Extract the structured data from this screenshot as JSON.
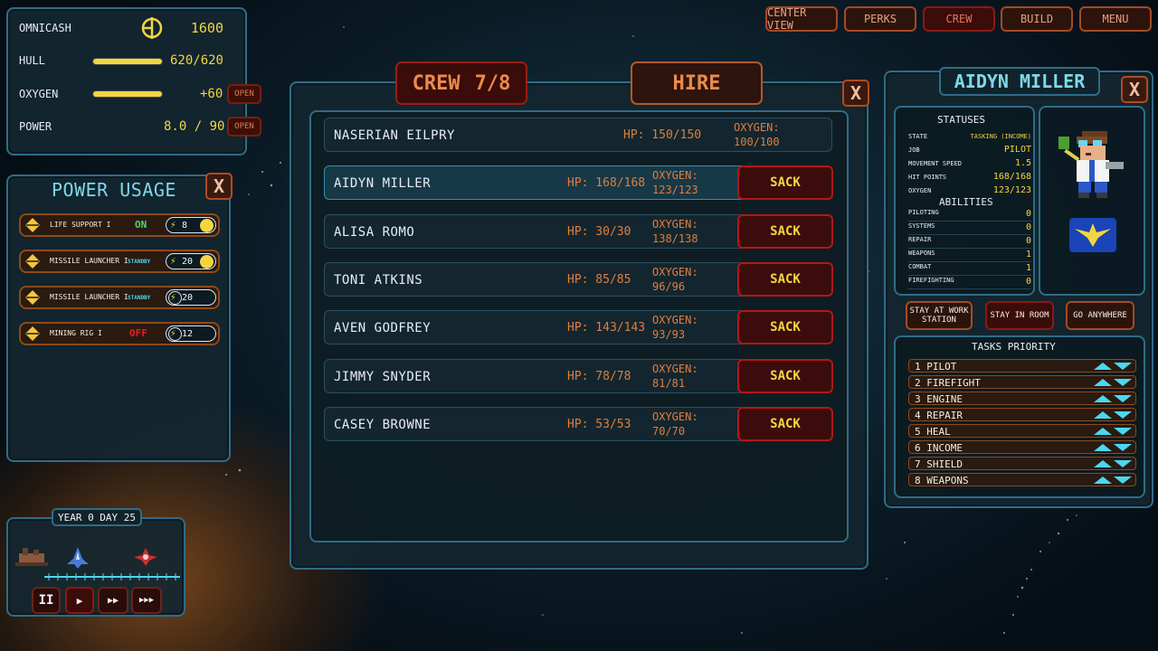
{
  "resources": {
    "omnicash_label": "OMNICASH",
    "omnicash_value": "1600",
    "hull_label": "HULL",
    "hull_value": "620/620",
    "hull_fraction": 1.0,
    "oxygen_label": "OXYGEN",
    "oxygen_value": "+60",
    "oxygen_fraction": 1.0,
    "oxygen_open": "OPEN",
    "power_label": "POWER",
    "power_value": "8.0 / 90.0",
    "power_open": "OPEN"
  },
  "top_menu": {
    "center_view": "CENTER VIEW",
    "perks": "PERKS",
    "crew": "CREW",
    "build": "BUILD",
    "menu": "MENU"
  },
  "power_usage": {
    "title": "POWER USAGE",
    "close": "X",
    "items": [
      {
        "name": "LIFE SUPPORT I",
        "state": "ON",
        "power": "8",
        "enabled": true
      },
      {
        "name": "MISSILE LAUNCHER I",
        "state": "STANDBY",
        "power": "20",
        "enabled": true
      },
      {
        "name": "MISSILE LAUNCHER I",
        "state": "STANDBY",
        "power": "20",
        "enabled": false
      },
      {
        "name": "MINING RIG I",
        "state": "OFF",
        "power": "12",
        "enabled": false
      }
    ]
  },
  "crew_panel": {
    "tab_crew": "CREW",
    "tab_count": "7/8",
    "tab_hire": "HIRE",
    "close": "X",
    "sack_label": "SACK",
    "members": [
      {
        "name": "NASERIAN EILPRY",
        "hp": "HP: 150/150",
        "oxygen_label": "OXYGEN:",
        "oxygen": "100/100",
        "can_sack": false
      },
      {
        "name": "AIDYN MILLER",
        "hp": "HP: 168/168",
        "oxygen_label": "OXYGEN:",
        "oxygen": "123/123",
        "can_sack": true
      },
      {
        "name": "ALISA ROMO",
        "hp": "HP: 30/30",
        "oxygen_label": "OXYGEN:",
        "oxygen": "138/138",
        "can_sack": true
      },
      {
        "name": "TONI ATKINS",
        "hp": "HP: 85/85",
        "oxygen_label": "OXYGEN:",
        "oxygen": "96/96",
        "can_sack": true
      },
      {
        "name": "AVEN GODFREY",
        "hp": "HP: 143/143",
        "oxygen_label": "OXYGEN:",
        "oxygen": "93/93",
        "can_sack": true
      },
      {
        "name": "JIMMY SNYDER",
        "hp": "HP: 78/78",
        "oxygen_label": "OXYGEN:",
        "oxygen": "81/81",
        "can_sack": true
      },
      {
        "name": "CASEY BROWNE",
        "hp": "HP: 53/53",
        "oxygen_label": "OXYGEN:",
        "oxygen": "70/70",
        "can_sack": true
      }
    ]
  },
  "crew_detail": {
    "name": "AIDYN MILLER",
    "close": "X",
    "statuses_title": "STATUSES",
    "statuses": [
      {
        "label": "STATE",
        "value": "TASKING (INCOME)"
      },
      {
        "label": "JOB",
        "value": "PILOT"
      },
      {
        "label": "MOVEMENT SPEED",
        "value": "1.5"
      },
      {
        "label": "HIT POINTS",
        "value": "168/168"
      },
      {
        "label": "OXYGEN",
        "value": "123/123"
      }
    ],
    "abilities_title": "ABILITIES",
    "abilities": [
      {
        "label": "PILOTING",
        "value": "0"
      },
      {
        "label": "SYSTEMS",
        "value": "0"
      },
      {
        "label": "REPAIR",
        "value": "0"
      },
      {
        "label": "WEAPONS",
        "value": "1"
      },
      {
        "label": "COMBAT",
        "value": "1"
      },
      {
        "label": "FIREFIGHTING",
        "value": "0"
      }
    ],
    "buttons": {
      "stay_station": "STAY AT WORK STATION",
      "stay_room": "STAY IN ROOM",
      "go_anywhere": "GO ANYWHERE"
    },
    "tasks_title": "TASKS PRIORITY",
    "tasks": [
      "1 PILOT",
      "2 FIREFIGHT",
      "3 ENGINE",
      "4 REPAIR",
      "5 HEAL",
      "6 INCOME",
      "7 SHIELD",
      "8 WEAPONS"
    ]
  },
  "timeline": {
    "date": "YEAR 0 DAY 25",
    "pause": "II",
    "play": "▶",
    "fast": "▶▶",
    "faster": "▶▶▶"
  },
  "colors": {
    "accent_yellow": "#f2d640",
    "accent_orange": "#e07e3c",
    "panel_border": "#2f6c86",
    "sack_red": "#b01818"
  }
}
